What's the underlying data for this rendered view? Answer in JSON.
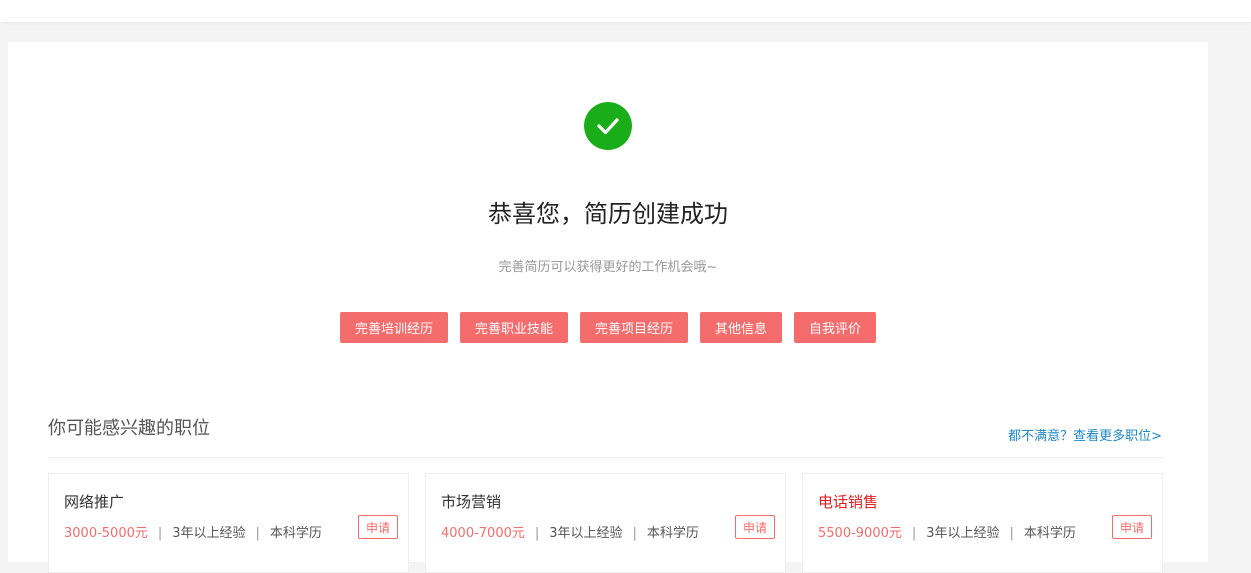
{
  "success": {
    "icon": "check-circle-icon",
    "icon_color": "#1aad19",
    "title": "恭喜您，简历创建成功",
    "subtitle": "完善简历可以获得更好的工作机会哦~"
  },
  "actions": [
    {
      "label": "完善培训经历"
    },
    {
      "label": "完善职业技能"
    },
    {
      "label": "完善项目经历"
    },
    {
      "label": "其他信息"
    },
    {
      "label": "自我评价"
    }
  ],
  "recommend": {
    "title": "你可能感兴趣的职位",
    "more_link": "都不满意？查看更多职位>"
  },
  "jobs": [
    {
      "title": "网络推广",
      "salary": "3000-5000元",
      "experience": "3年以上经验",
      "education": "本科学历",
      "apply_label": "申请",
      "highlight": false
    },
    {
      "title": "市场营销",
      "salary": "4000-7000元",
      "experience": "3年以上经验",
      "education": "本科学历",
      "apply_label": "申请",
      "highlight": false
    },
    {
      "title": "电话销售",
      "salary": "5500-9000元",
      "experience": "3年以上经验",
      "education": "本科学历",
      "apply_label": "申请",
      "highlight": true
    }
  ],
  "colors": {
    "accent": "#f56c6c",
    "success": "#1aad19",
    "link": "#1e88c9",
    "hot_title": "#e02020"
  }
}
